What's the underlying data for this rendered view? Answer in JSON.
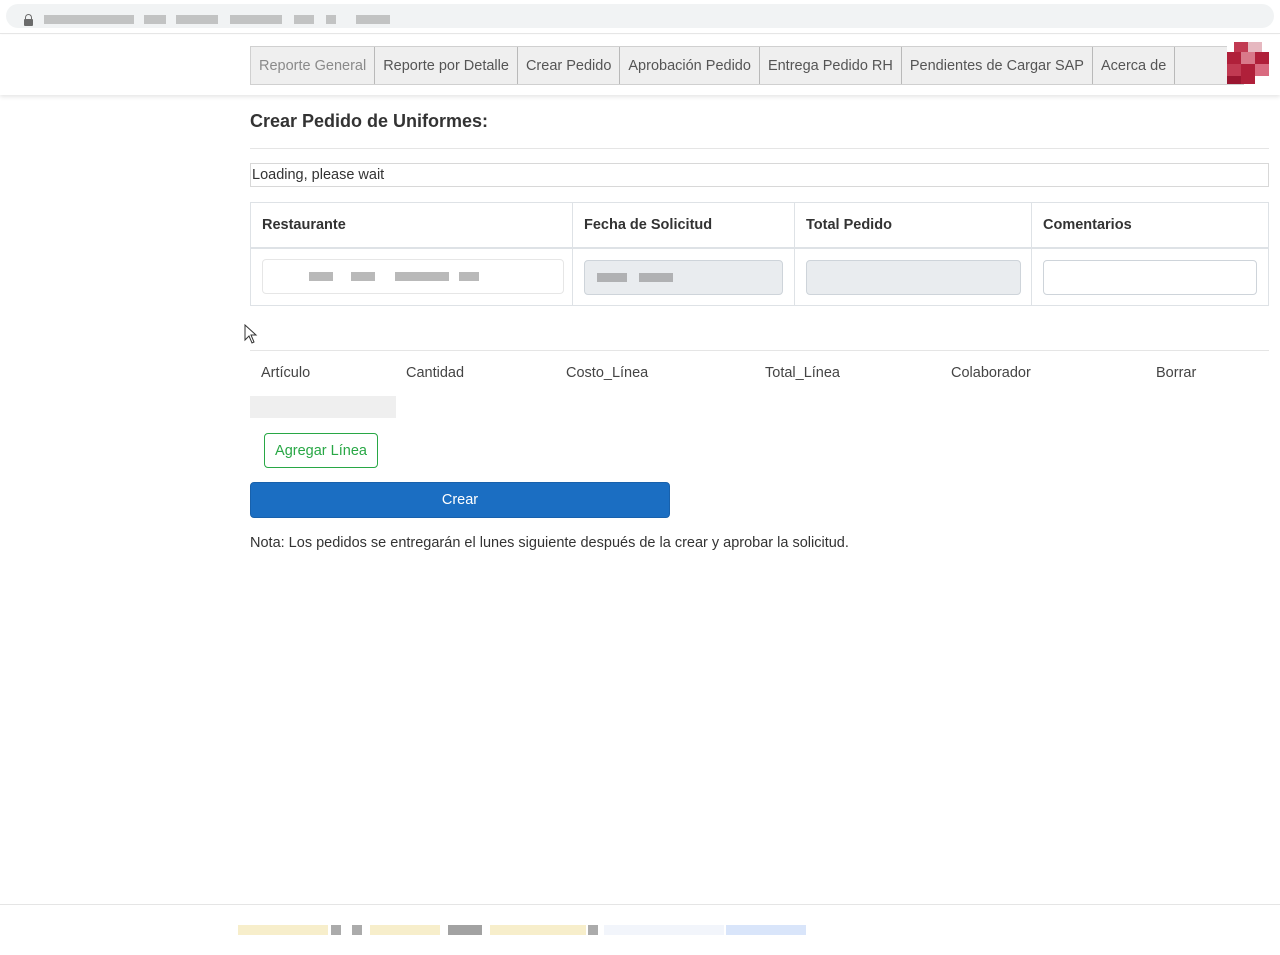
{
  "nav": {
    "tabs": [
      {
        "label": "Reporte General"
      },
      {
        "label": "Reporte por Detalle"
      },
      {
        "label": "Crear Pedido"
      },
      {
        "label": "Aprobación Pedido"
      },
      {
        "label": "Entrega Pedido RH"
      },
      {
        "label": "Pendientes de Cargar SAP"
      },
      {
        "label": "Acerca de"
      }
    ]
  },
  "main": {
    "title": "Crear Pedido de Uniformes:",
    "loading": "Loading, please wait",
    "header_columns": [
      "Restaurante",
      "Fecha de Solicitud",
      "Total Pedido",
      "Comentarios"
    ],
    "line_columns": [
      "Artículo",
      "Cantidad",
      "Costo_Línea",
      "Total_Línea",
      "Colaborador",
      "Borrar"
    ],
    "add_line_label": "Agregar Línea",
    "submit_label": "Crear",
    "note": "Nota: Los pedidos se entregarán el lunes siguiente después de la crear y aprobar la solicitud."
  },
  "colors": {
    "primary": "#1b6ec2",
    "success": "#28a745",
    "logo": "#b0203a"
  }
}
